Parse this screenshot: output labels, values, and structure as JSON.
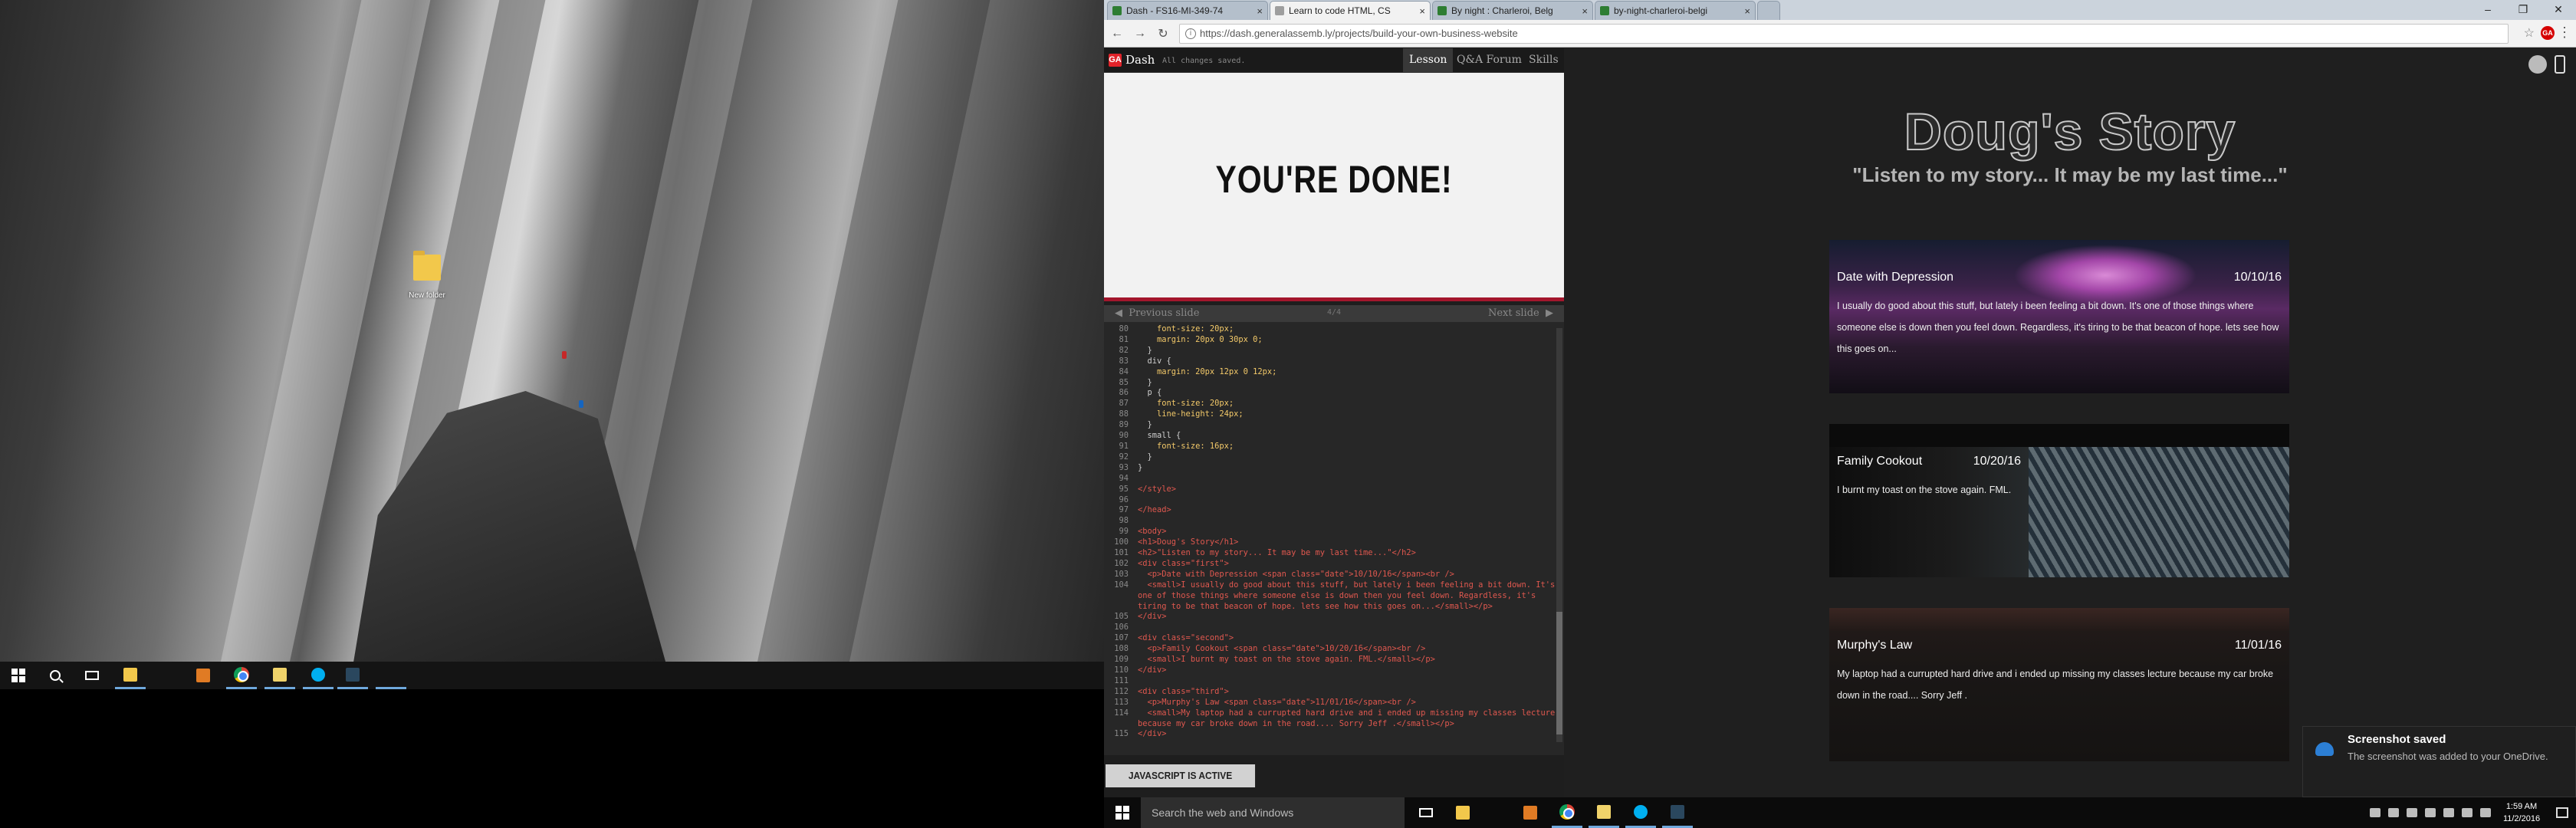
{
  "desktop": {
    "folder_label": "New folder"
  },
  "browser": {
    "tabs": [
      {
        "label": "Dash - FS16-MI-349-74",
        "favicon_color": "#2e7d32"
      },
      {
        "label": "Learn to code HTML, CS",
        "favicon_color": "#9e9e9e"
      },
      {
        "label": "By night : Charleroi, Belg",
        "favicon_color": "#2e7d32"
      },
      {
        "label": "by-night-charleroi-belgi",
        "favicon_color": "#2e7d32"
      }
    ],
    "url": "https://dash.generalassemb.ly/projects/build-your-own-business-website"
  },
  "dash": {
    "logo_text": "GA",
    "name": "Dash",
    "saved_status": "All changes saved.",
    "nav": [
      "Lesson",
      "Q&A Forum",
      "Skills"
    ],
    "slide_title": "YOU'RE DONE!",
    "prev_slide": "Previous slide",
    "next_slide": "Next slide",
    "slide_count": "4/4",
    "js_button": "JAVASCRIPT IS ACTIVE"
  },
  "code": [
    {
      "n": "80",
      "t": "    font-size: 20px;",
      "k": "prop"
    },
    {
      "n": "81",
      "t": "    margin: 20px 0 30px 0;",
      "k": "prop"
    },
    {
      "n": "82",
      "t": "  }",
      "k": "plain"
    },
    {
      "n": "83",
      "t": "  div {",
      "k": "plain"
    },
    {
      "n": "84",
      "t": "    margin: 20px 12px 0 12px;",
      "k": "prop"
    },
    {
      "n": "85",
      "t": "  }",
      "k": "plain"
    },
    {
      "n": "86",
      "t": "  p {",
      "k": "plain"
    },
    {
      "n": "87",
      "t": "    font-size: 20px;",
      "k": "prop"
    },
    {
      "n": "88",
      "t": "    line-height: 24px;",
      "k": "prop"
    },
    {
      "n": "89",
      "t": "  }",
      "k": "plain"
    },
    {
      "n": "90",
      "t": "  small {",
      "k": "plain"
    },
    {
      "n": "91",
      "t": "    font-size: 16px;",
      "k": "prop"
    },
    {
      "n": "92",
      "t": "  }",
      "k": "plain"
    },
    {
      "n": "93",
      "t": "}",
      "k": "plain"
    },
    {
      "n": "94",
      "t": "",
      "k": "plain"
    },
    {
      "n": "95",
      "t": "</style>",
      "k": "tag"
    },
    {
      "n": "96",
      "t": "",
      "k": "plain"
    },
    {
      "n": "97",
      "t": "</head>",
      "k": "tag"
    },
    {
      "n": "98",
      "t": "",
      "k": "plain"
    },
    {
      "n": "99",
      "t": "<body>",
      "k": "tag"
    },
    {
      "n": "100",
      "t": "<h1>Doug's Story</h1>",
      "k": "tag"
    },
    {
      "n": "101",
      "t": "<h2>\"Listen to my story... It may be my last time...\"</h2>",
      "k": "tag"
    },
    {
      "n": "102",
      "t": "<div class=\"first\">",
      "k": "tag"
    },
    {
      "n": "103",
      "t": "  <p>Date with Depression <span class=\"date\">10/10/16</span><br />",
      "k": "tag"
    },
    {
      "n": "104",
      "t": "  <small>I usually do good about this stuff, but lately i been feeling a bit down. It's one of those things where someone else is down then you feel down. Regardless, it's tiring to be that beacon of hope. lets see how this goes on...</small></p>",
      "k": "tag",
      "wrap": true
    },
    {
      "n": "105",
      "t": "</div>",
      "k": "tag"
    },
    {
      "n": "106",
      "t": "",
      "k": "plain"
    },
    {
      "n": "107",
      "t": "<div class=\"second\">",
      "k": "tag"
    },
    {
      "n": "108",
      "t": "  <p>Family Cookout <span class=\"date\">10/20/16</span><br />",
      "k": "tag"
    },
    {
      "n": "109",
      "t": "  <small>I burnt my toast on the stove again. FML.</small></p>",
      "k": "tag"
    },
    {
      "n": "110",
      "t": "</div>",
      "k": "tag"
    },
    {
      "n": "111",
      "t": "",
      "k": "plain"
    },
    {
      "n": "112",
      "t": "<div class=\"third\">",
      "k": "tag"
    },
    {
      "n": "113",
      "t": "  <p>Murphy's Law <span class=\"date\">11/01/16</span><br />",
      "k": "tag"
    },
    {
      "n": "114",
      "t": "  <small>My laptop had a currupted hard drive and i ended up missing my classes lecture because my car broke down in the road.... Sorry Jeff .</small></p>",
      "k": "tag",
      "wrap": true
    },
    {
      "n": "115",
      "t": "</div>",
      "k": "tag"
    }
  ],
  "output": {
    "title": "Doug's Story",
    "subtitle": "\"Listen to my story... It may be my last time...\"",
    "cards": [
      {
        "heading": "Date with Depression",
        "date": "10/10/16",
        "body": "I usually do good about this stuff, but lately i been feeling a bit down. It's one of those things where someone else is down then you feel down. Regardless, it's tiring to be that beacon of hope. lets see how this goes on..."
      },
      {
        "heading": "Family Cookout",
        "date": "10/20/16",
        "body": "I burnt my toast on the stove again. FML."
      },
      {
        "heading": "Murphy's Law",
        "date": "11/01/16",
        "body": "My laptop had a currupted hard drive and i ended up missing my classes lecture because my car broke down in the road.... Sorry Jeff ."
      }
    ]
  },
  "taskbar": {
    "search_placeholder": "Search the web and Windows",
    "time": "1:59 AM",
    "date": "11/2/2016"
  },
  "toast": {
    "title": "Screenshot saved",
    "body": "The screenshot was added to your OneDrive."
  }
}
